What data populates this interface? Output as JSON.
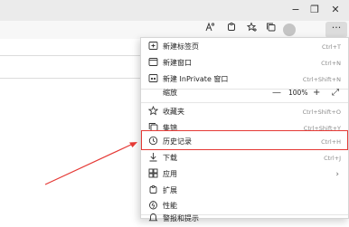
{
  "window_controls": {
    "minimize": "−",
    "restore": "❐",
    "close": "✕"
  },
  "toolbar_icons": [
    "font-zoom-icon",
    "extensions-icon",
    "favorites-icon",
    "collections-icon",
    "profile-icon",
    "more-icon"
  ],
  "toolbar_more_label": "···",
  "menu": {
    "items": [
      {
        "icon": "new-tab-icon",
        "label": "新建标签页",
        "shortcut": "Ctrl+T"
      },
      {
        "icon": "new-window-icon",
        "label": "新建窗口",
        "shortcut": "Ctrl+N"
      },
      {
        "icon": "inprivate-icon",
        "label": "新建 InPrivate 窗口",
        "shortcut": "Ctrl+Shift+N"
      },
      {
        "icon": "",
        "label": "缩放",
        "zoom": {
          "minus": "—",
          "value": "100%",
          "plus": "+",
          "fullscreen": "⤢"
        }
      },
      {
        "icon": "favorites-icon",
        "label": "收藏夹",
        "shortcut": "Ctrl+Shift+O"
      },
      {
        "icon": "collections-icon",
        "label": "集锦",
        "shortcut": "Ctrl+Shift+Y"
      },
      {
        "icon": "history-icon",
        "label": "历史记录",
        "shortcut": "Ctrl+H"
      },
      {
        "icon": "download-icon",
        "label": "下载",
        "shortcut": "Ctrl+J"
      },
      {
        "icon": "apps-icon",
        "label": "应用",
        "chevron": "›"
      },
      {
        "icon": "extensions-icon",
        "label": "扩展"
      },
      {
        "icon": "performance-icon",
        "label": "性能"
      },
      {
        "icon": "alert-icon",
        "label": "警报和提示"
      }
    ]
  },
  "annotation": {
    "color": "#e53935",
    "target": "历史记录"
  }
}
